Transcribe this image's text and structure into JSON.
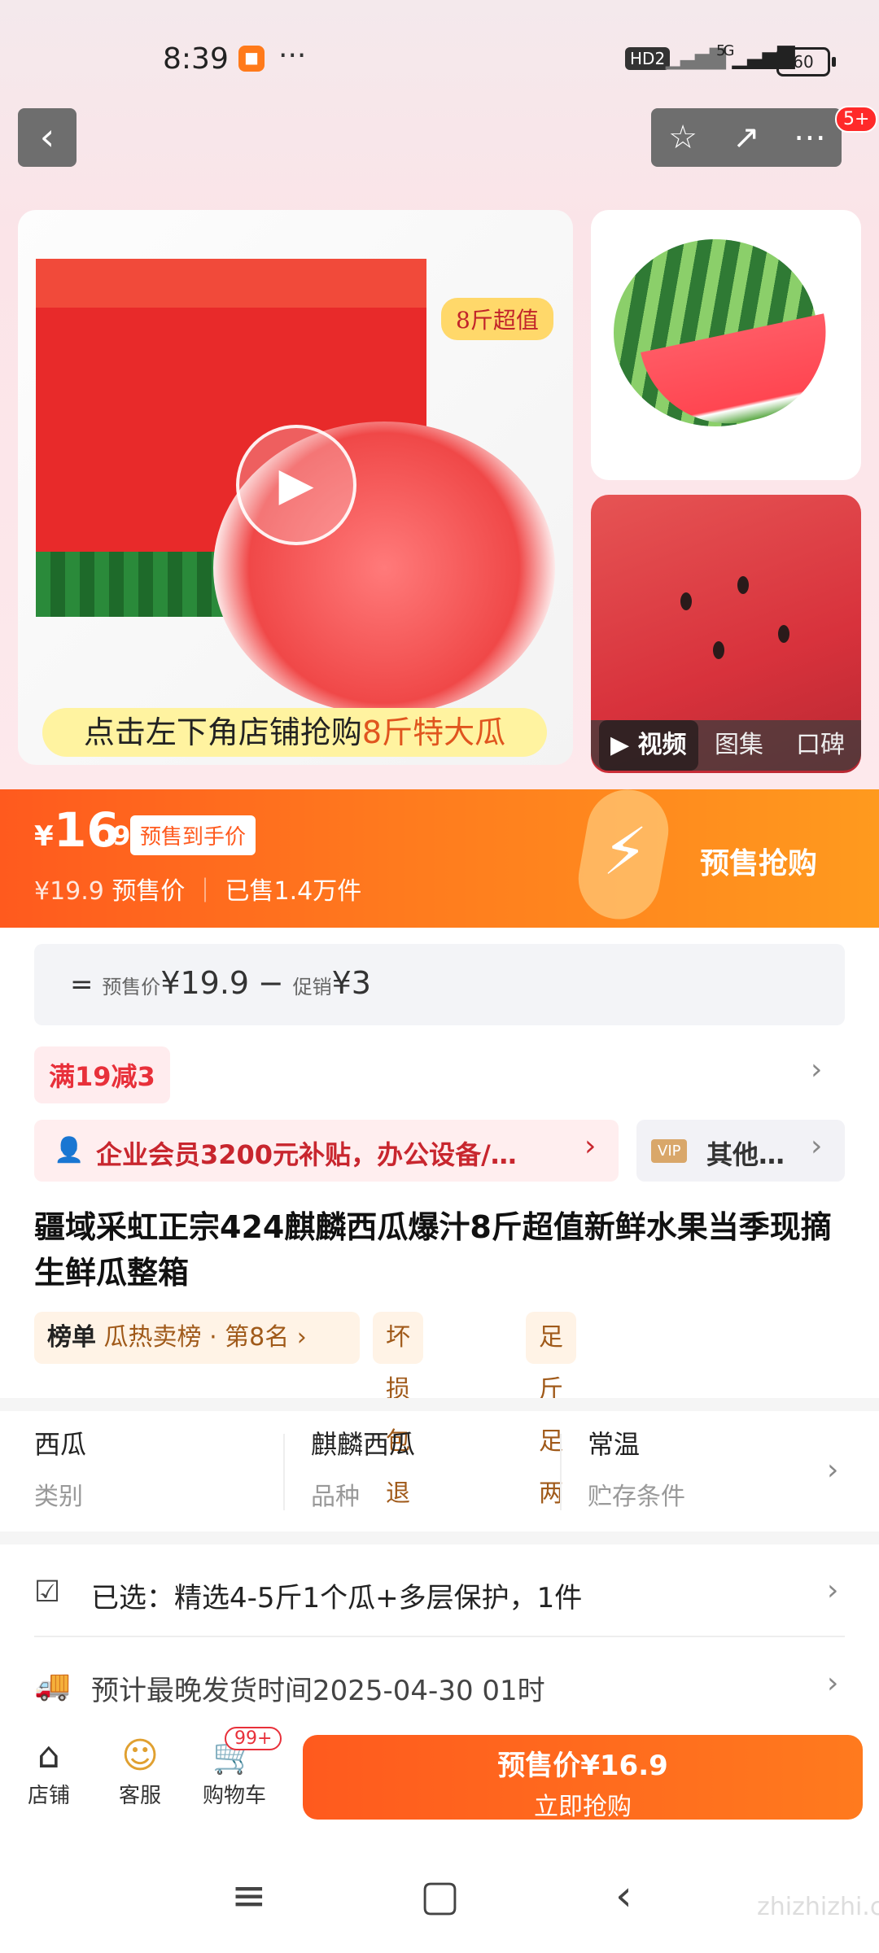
{
  "status_bar": {
    "time": "8:39",
    "hd": "HD2",
    "net": "5G",
    "battery": "60"
  },
  "header": {
    "back": "‹",
    "star": "☆",
    "share": "↗",
    "more": "⋯",
    "badge": "5+"
  },
  "media": {
    "badge_weight": "8斤超值",
    "caption_prefix": "点击左下角店铺抢购",
    "caption_highlight": "8斤特大瓜",
    "tabs": [
      {
        "label": "▶ 视频"
      },
      {
        "label": "图集"
      },
      {
        "label": "口碑"
      }
    ]
  },
  "price": {
    "yen": "¥",
    "integer": "16",
    "decimal": ".9",
    "tag": "预售到手价",
    "original": "¥19.9",
    "presale_label": "预售价",
    "sold": "已售1.4万件",
    "cta": "预售抢购"
  },
  "calc": {
    "eq": "=",
    "presale_small": "预售价",
    "presale_value": "¥19.9",
    "minus": "−",
    "promo_small": "促销",
    "promo_value": "¥3"
  },
  "coupon": {
    "label": "满19减3"
  },
  "vip": {
    "main": "企业会员3200元补贴，办公设备/…",
    "badge": "VIP",
    "other": "其他…"
  },
  "product": {
    "title": "疆域采虹正宗424麒麟西瓜爆汁8斤超值新鲜水果当季现摘生鲜瓜整箱",
    "rank_label": "榜单",
    "rank_value": "瓜热卖榜 · 第8名",
    "tag2": "坏损包退",
    "tag3": "足斤足两"
  },
  "attributes": [
    {
      "value": "西瓜",
      "label": "类别"
    },
    {
      "value": "麒麟西瓜",
      "label": "品种"
    },
    {
      "value": "常温",
      "label": "贮存条件"
    }
  ],
  "rows": {
    "selected": "已选：精选4-5斤1个瓜+多层保护，1件",
    "shipping": "预计最晚发货时间2025-04-30 01时"
  },
  "bottom_bar": {
    "shop": "店铺",
    "service": "客服",
    "cart": "购物车",
    "cart_badge": "99+",
    "buy_line1": "预售价¥16.9",
    "buy_line2": "立即抢购"
  },
  "watermark": "zhizhizhi.com",
  "colors": {
    "accent": "#ff6a1e",
    "red": "#e8303a"
  }
}
